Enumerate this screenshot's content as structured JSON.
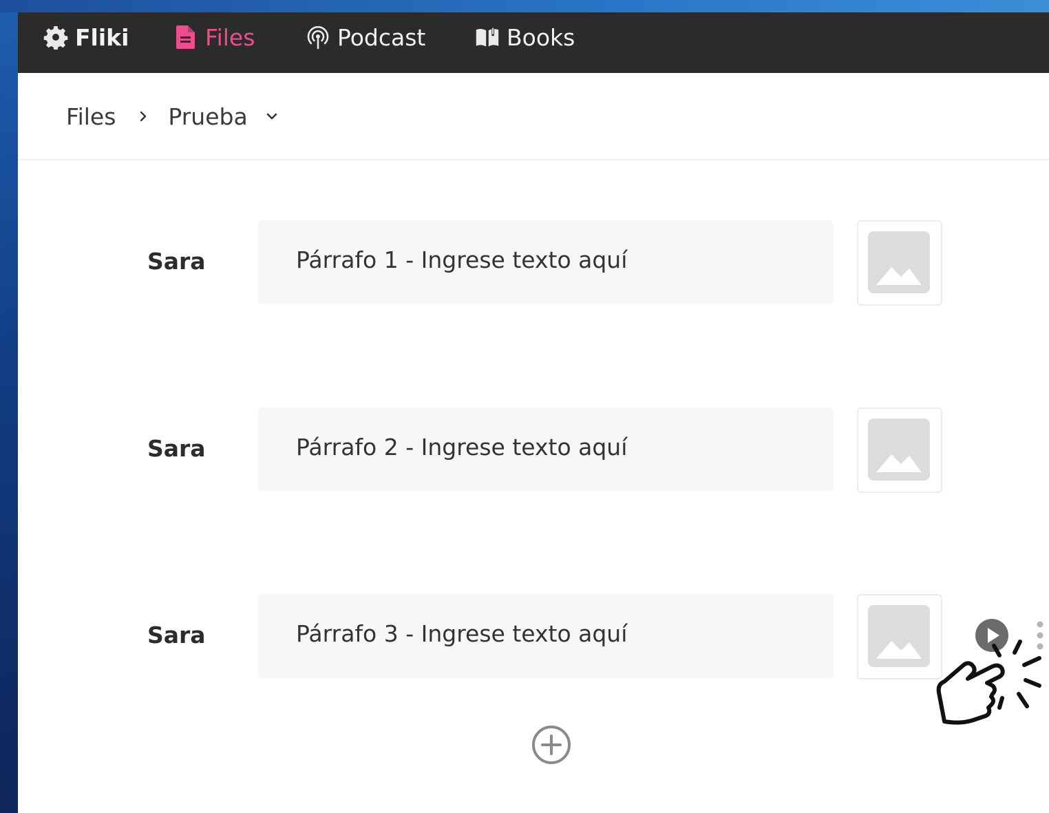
{
  "nav": {
    "items": [
      {
        "label": "Fliki",
        "icon": "gear-logo-icon"
      },
      {
        "label": "Files",
        "icon": "file-icon",
        "active": true
      },
      {
        "label": "Podcast",
        "icon": "podcast-icon"
      },
      {
        "label": "Books",
        "icon": "book-icon"
      }
    ],
    "active_color": "#ee4d8d",
    "background": "#2b2b2b"
  },
  "breadcrumb": {
    "root": "Files",
    "current": "Prueba"
  },
  "rows": [
    {
      "speaker": "Sara",
      "text": "Párrafo 1 - Ingrese texto aquí",
      "media_icon": "image-placeholder-icon"
    },
    {
      "speaker": "Sara",
      "text": "Párrafo 2 - Ingrese texto aquí",
      "media_icon": "image-placeholder-icon"
    },
    {
      "speaker": "Sara",
      "text": "Párrafo 3 - Ingrese texto aquí",
      "media_icon": "image-placeholder-icon"
    }
  ],
  "row_actions": {
    "play_icon": "play-icon",
    "more_icon": "more-vertical-icon",
    "cursor_icon": "hand-pointer-click-icon"
  },
  "add_button_icon": "add-circle-icon"
}
